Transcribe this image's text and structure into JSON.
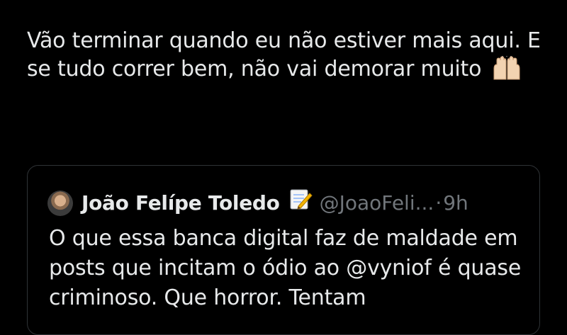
{
  "tweet": {
    "text": "Vão terminar quando eu não estiver mais aqui. E se tudo correr bem, não vai demorar muito",
    "emoji": "raising-hands-emoji"
  },
  "quote": {
    "author_name": "João Felípe Toledo",
    "badge_icon": "memo-icon",
    "handle": "@JoaoFeli...",
    "separator": "·",
    "time": "9h",
    "text": "O que essa banca digital faz de maldade em posts que incitam o ódio ao @vyniof é quase criminoso. Que horror. Tentam"
  },
  "colors": {
    "background": "#000000",
    "text": "#e7e9ea",
    "secondary": "#71767b",
    "border": "#2f3336"
  }
}
